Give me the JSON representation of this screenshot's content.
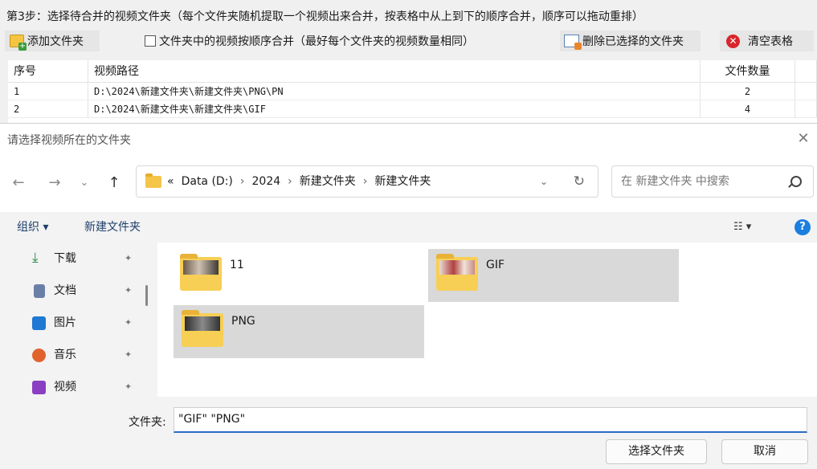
{
  "app": {
    "step_title": "第3步：选择待合并的视频文件夹（每个文件夹随机提取一个视频出来合并，按表格中从上到下的顺序合并，顺序可以拖动重排）",
    "toolbar": {
      "add_folder": "添加文件夹",
      "sequential_checkbox": "文件夹中的视频按顺序合并（最好每个文件夹的视频数量相同）",
      "delete_selected": "删除已选择的文件夹",
      "clear_table": "清空表格"
    },
    "table": {
      "headers": [
        "序号",
        "视频路径",
        "文件数量"
      ],
      "rows": [
        {
          "index": "1",
          "path": "D:\\2024\\新建文件夹\\新建文件夹\\PNG\\PN",
          "count": "2"
        },
        {
          "index": "2",
          "path": "D:\\2024\\新建文件夹\\新建文件夹\\GIF",
          "count": "4"
        }
      ]
    }
  },
  "dialog": {
    "title": "请选择视频所在的文件夹",
    "nav_buttons": {
      "back": "←",
      "forward": "→",
      "recent": "⌄",
      "up": "↑"
    },
    "breadcrumb": [
      "«",
      "Data (D:)",
      "2024",
      "新建文件夹",
      "新建文件夹"
    ],
    "breadcrumb_sep": "›",
    "search_placeholder": "在 新建文件夹 中搜索",
    "commands": {
      "organize": "组织 ▾",
      "new_folder": "新建文件夹"
    },
    "nav_pane": [
      {
        "label": "下载",
        "icon": "download-icon",
        "color": "#2a8a4a"
      },
      {
        "label": "文档",
        "icon": "document-icon",
        "color": "#6a7fa8"
      },
      {
        "label": "图片",
        "icon": "pictures-icon",
        "color": "#1f78d1"
      },
      {
        "label": "音乐",
        "icon": "music-icon",
        "color": "#e0632e"
      },
      {
        "label": "视频",
        "icon": "video-icon",
        "color": "#8a3fc2"
      }
    ],
    "pin_glyph": "✦",
    "folders": [
      {
        "name": "11",
        "selected": false
      },
      {
        "name": "GIF",
        "selected": true
      },
      {
        "name": "PNG",
        "selected": true
      }
    ],
    "filename_label": "文件夹:",
    "filename_value": "\"GIF\" \"PNG\"",
    "buttons": {
      "select": "选择文件夹",
      "cancel": "取消"
    }
  }
}
